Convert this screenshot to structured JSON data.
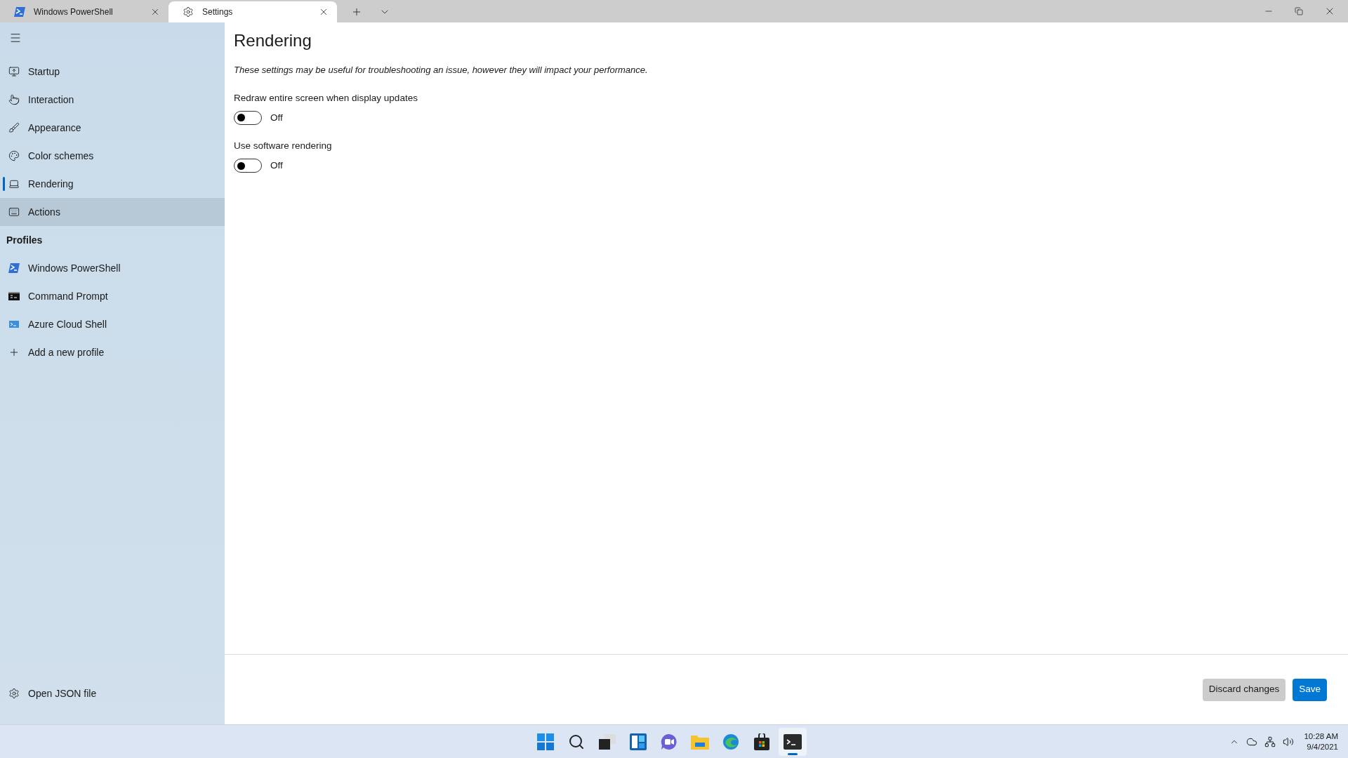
{
  "tabs": [
    {
      "title": "Windows PowerShell",
      "selected": false
    },
    {
      "title": "Settings",
      "selected": true
    }
  ],
  "sidebar": {
    "items": [
      {
        "label": "Startup",
        "selected": false,
        "hovered": false
      },
      {
        "label": "Interaction",
        "selected": false,
        "hovered": false
      },
      {
        "label": "Appearance",
        "selected": false,
        "hovered": false
      },
      {
        "label": "Color schemes",
        "selected": false,
        "hovered": false
      },
      {
        "label": "Rendering",
        "selected": true,
        "hovered": false
      },
      {
        "label": "Actions",
        "selected": false,
        "hovered": true
      }
    ],
    "profiles_heading": "Profiles",
    "profiles": [
      {
        "label": "Windows PowerShell"
      },
      {
        "label": "Command Prompt"
      },
      {
        "label": "Azure Cloud Shell"
      },
      {
        "label": "Add a new profile"
      }
    ],
    "footer_item": "Open JSON file"
  },
  "page": {
    "title": "Rendering",
    "note": "These settings may be useful for troubleshooting an issue, however they will impact your performance.",
    "settings": [
      {
        "label": "Redraw entire screen when display updates",
        "on": false,
        "state_text": "Off"
      },
      {
        "label": "Use software rendering",
        "on": false,
        "state_text": "Off"
      }
    ]
  },
  "buttons": [
    {
      "label": "Discard changes",
      "kind": "secondary"
    },
    {
      "label": "Save",
      "kind": "primary"
    }
  ],
  "taskbar": {
    "apps": [
      {
        "active": false
      },
      {
        "active": false
      },
      {
        "active": false
      },
      {
        "active": false
      },
      {
        "active": false
      },
      {
        "active": false
      },
      {
        "active": false
      },
      {
        "active": false
      },
      {
        "active": true
      }
    ],
    "time": "10:28 AM",
    "date": "9/4/2021"
  }
}
